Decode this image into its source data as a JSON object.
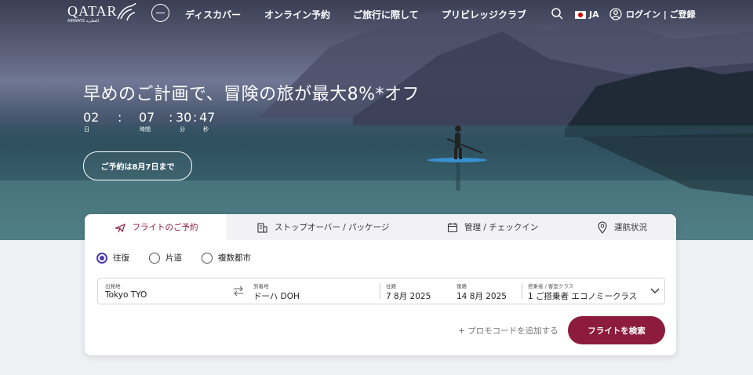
{
  "header": {
    "logo_text": "QATAR",
    "logo_sub": "AIRWAYS القطرية",
    "oneworld_label": "oneworld",
    "nav": [
      "ディスカバー",
      "オンライン予約",
      "ご旅行に際して",
      "プリビレッジクラブ"
    ],
    "language": "JA",
    "login": "ログイン | ご登録"
  },
  "hero": {
    "headline": "早めのご計画で、冒険の旅が最大8%*オフ",
    "countdown": {
      "days": "02",
      "days_label": "日",
      "hours": "07",
      "hours_label": "時間",
      "minutes": "30",
      "minutes_label": "分",
      "seconds": "47",
      "seconds_label": "秒",
      "sep": ":"
    },
    "cta": "ご予約は8月7日まで"
  },
  "booking": {
    "tabs": [
      {
        "label": "フライトのご予約",
        "icon": "plane-icon"
      },
      {
        "label": "ストップオーバー / パッケージ",
        "icon": "hotel-icon"
      },
      {
        "label": "管理 / チェックイン",
        "icon": "calendar-icon"
      },
      {
        "label": "運航状況",
        "icon": "location-pin-icon"
      }
    ],
    "trip_types": [
      "往復",
      "片道",
      "複数都市"
    ],
    "selected_trip_type": "往復",
    "fields": {
      "from_label": "出発地",
      "from_value": "Tokyo TYO",
      "to_label": "到着地",
      "to_value": "ドーハ DOH",
      "depart_label": "往路",
      "depart_value": "7 8月 2025",
      "return_label": "復路",
      "return_value": "14 8月 2025",
      "pax_label": "搭乗者 / 客室クラス",
      "pax_value": "1 ご搭乗者 エコノミークラス"
    },
    "promo": "+ プロモコードを追加する",
    "search": "フライトを検索"
  },
  "colors": {
    "brand": "#8d1b3d",
    "radio_selected": "#4b3db0"
  }
}
